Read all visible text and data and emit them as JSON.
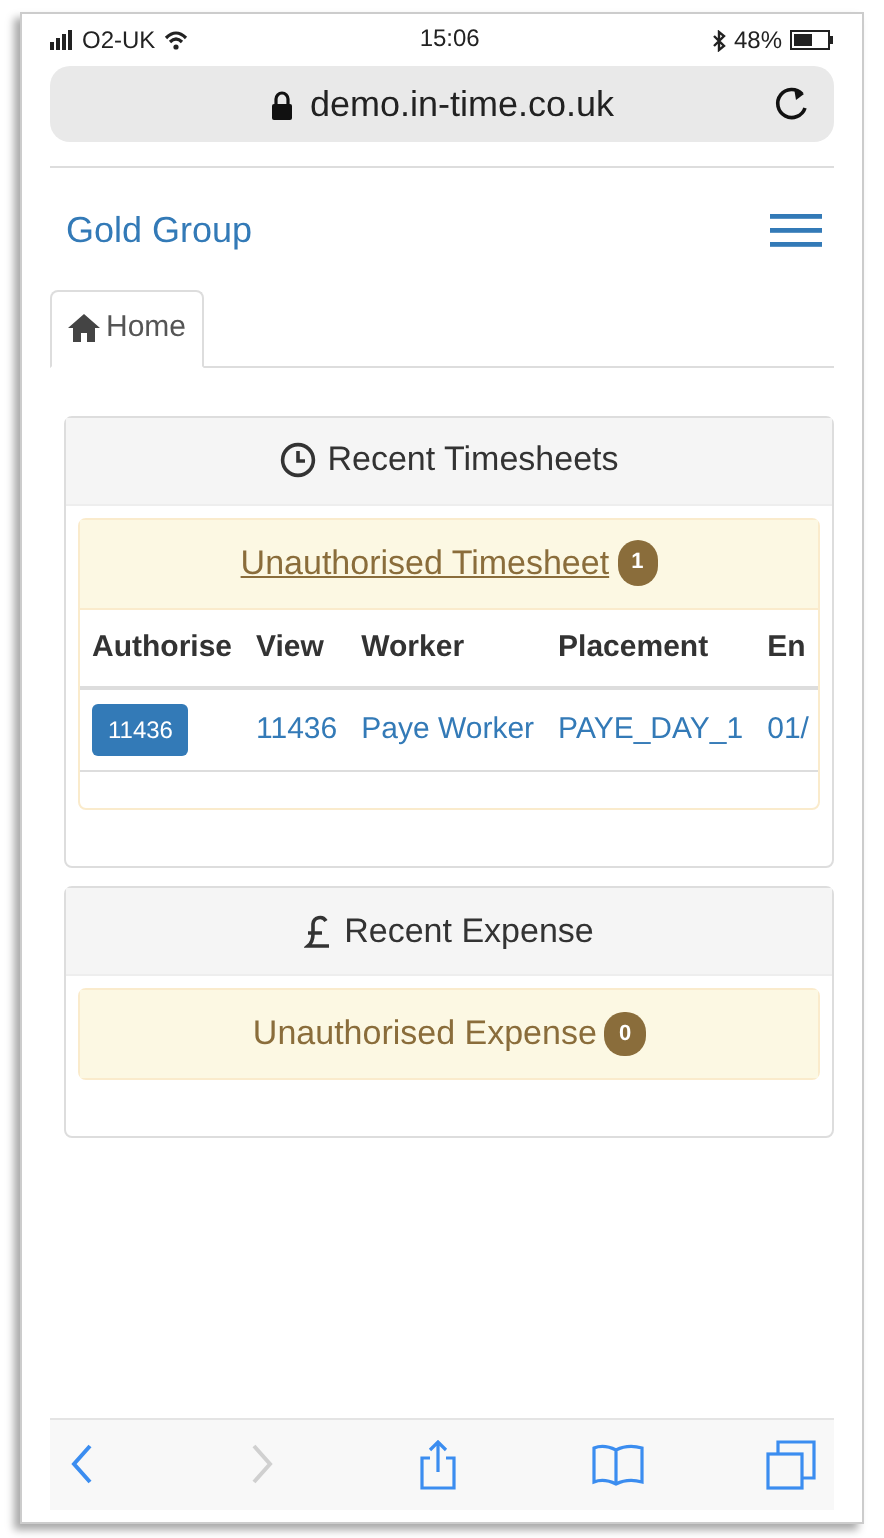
{
  "status_bar": {
    "carrier": "O2-UK",
    "time": "15:06",
    "battery": "48%"
  },
  "address_bar": {
    "url": "demo.in-time.co.uk"
  },
  "navbar": {
    "brand": "Gold Group"
  },
  "tabs": [
    {
      "label": "Home",
      "selected": true
    }
  ],
  "panels": [
    {
      "title": "Recent Timesheets",
      "kind": "clock",
      "section": {
        "title": "Unauthorised Timesheet",
        "link": true,
        "count": "1",
        "table": {
          "columns": [
            "Authorise",
            "View",
            "Worker",
            "Placement",
            "En"
          ],
          "rows": [
            {
              "authorise": "11436",
              "view": "11436",
              "worker": "Paye Worker",
              "placement": "PAYE_DAY_1",
              "column_5": "01/"
            }
          ]
        }
      }
    },
    {
      "title": "Recent Expense",
      "kind": "pound",
      "section": {
        "title": "Unauthorised Expense",
        "link": false,
        "count": "0"
      }
    }
  ],
  "toolbar": [
    {
      "kind": "back",
      "disabled": false
    },
    {
      "kind": "forward",
      "disabled": true
    },
    {
      "kind": "share",
      "disabled": false
    },
    {
      "kind": "bookmarks",
      "disabled": false
    },
    {
      "kind": "tabs",
      "disabled": false
    }
  ]
}
